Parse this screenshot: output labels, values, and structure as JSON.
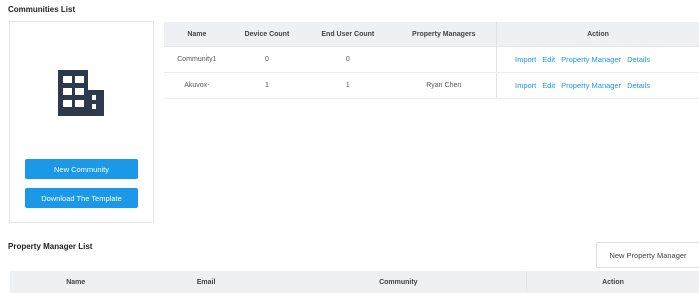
{
  "communities": {
    "title": "Communities List",
    "new_community_label": "New Community",
    "download_template_label": "Download The Template",
    "columns": [
      "Name",
      "Device Count",
      "End User Count",
      "Property Managers",
      "Action"
    ],
    "rows": [
      {
        "name": "Community1",
        "device_count": "0",
        "end_user_count": "0",
        "property_managers": "",
        "actions": [
          "Import",
          "Edit",
          "Property Manager",
          "Details"
        ]
      },
      {
        "name": "Akuvox-",
        "device_count": "1",
        "end_user_count": "1",
        "property_managers": "Ryan Chen",
        "actions": [
          "Import",
          "Edit",
          "Property Manager",
          "Details"
        ]
      }
    ]
  },
  "property_managers": {
    "title": "Property Manager List",
    "new_button_label": "New Property Manager",
    "columns": [
      "Name",
      "Email",
      "Community",
      "Action"
    ]
  },
  "colors": {
    "accent": "#1b98e8",
    "header_bg": "#eef0f4"
  },
  "icons": {
    "community": "building-icon"
  }
}
